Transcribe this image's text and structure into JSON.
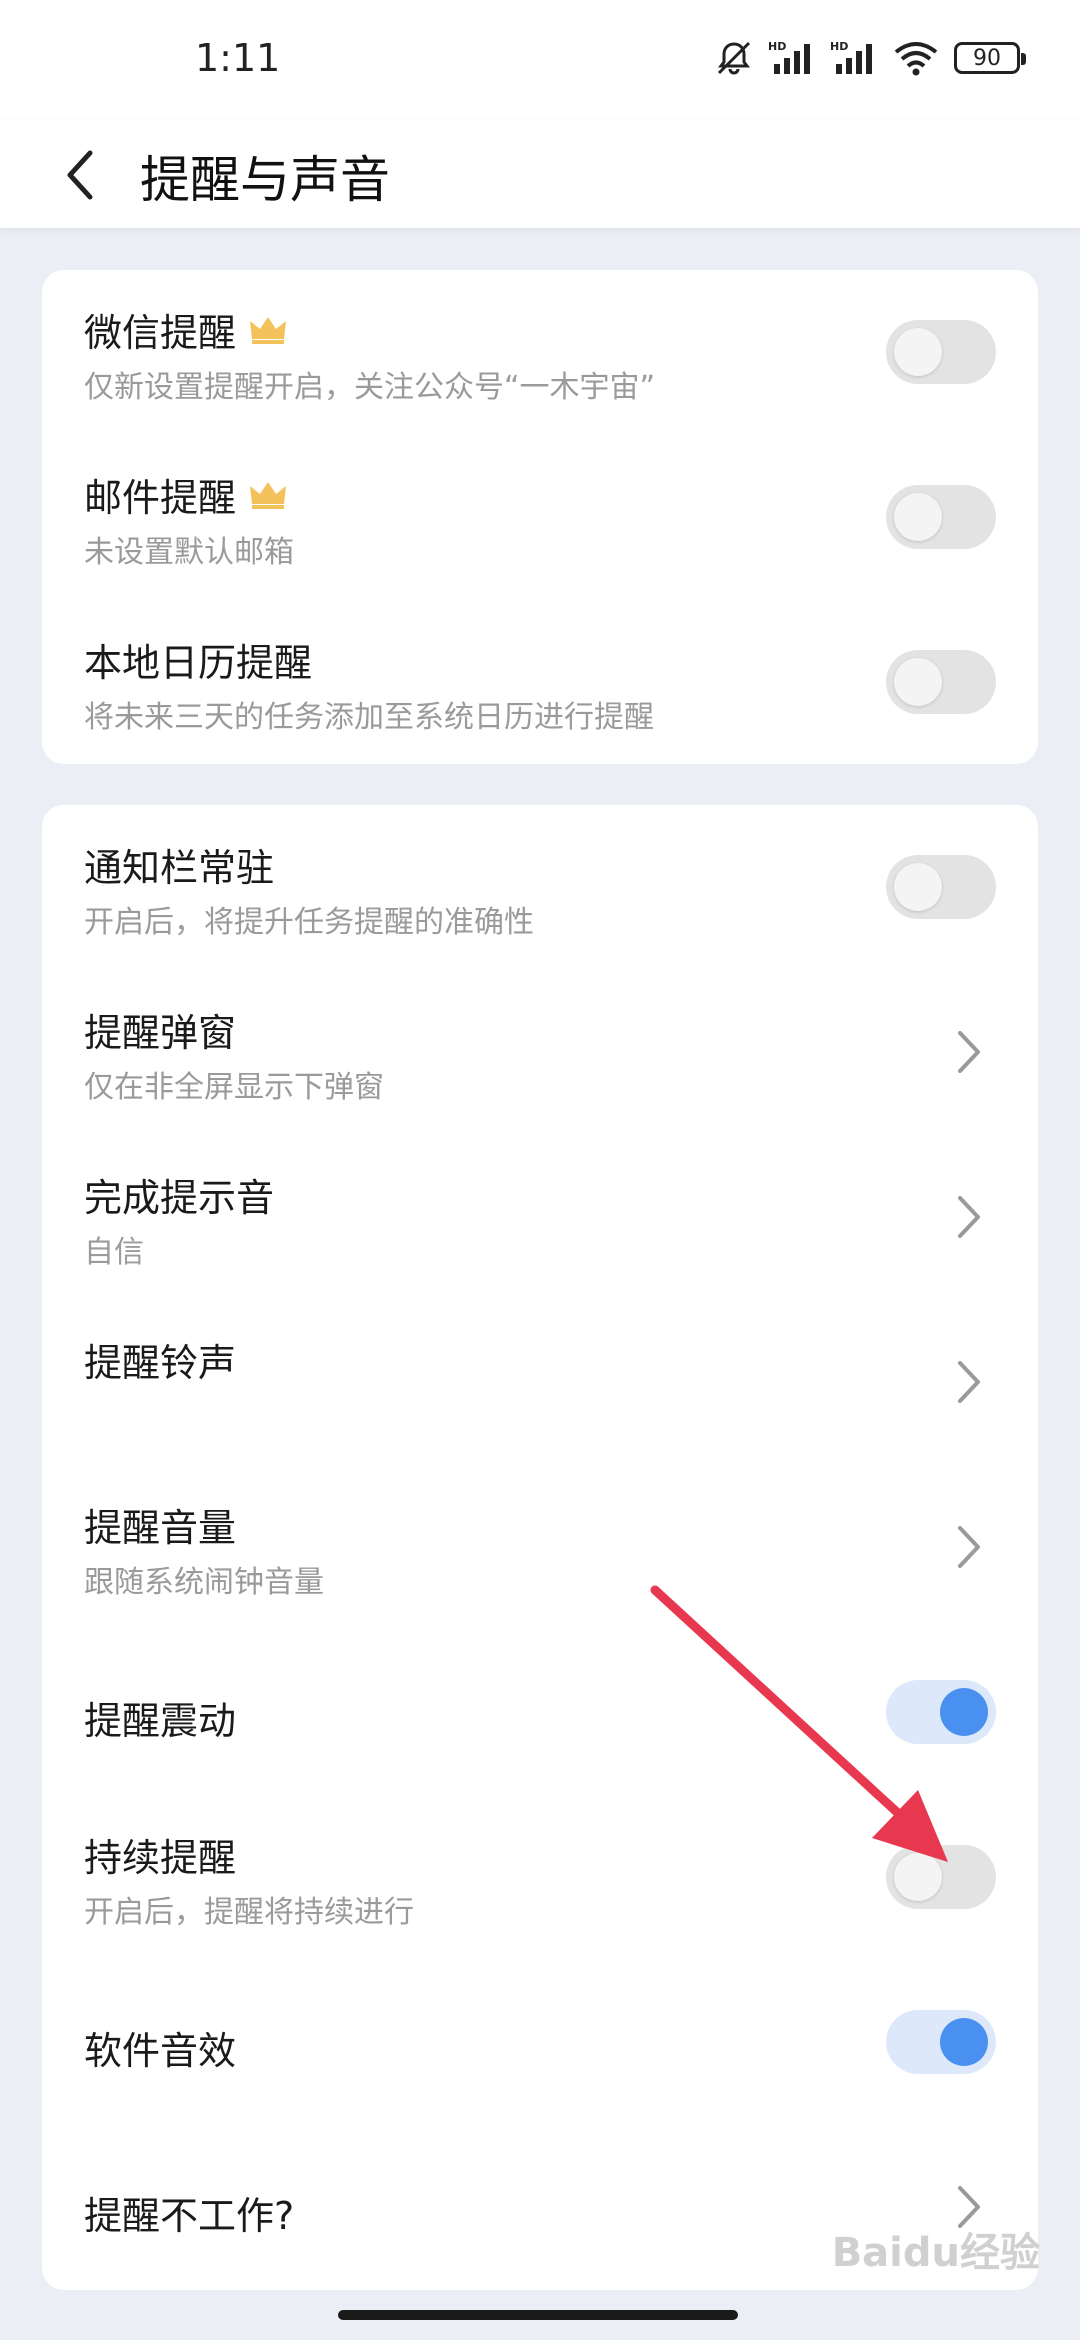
{
  "status": {
    "time": "1:11",
    "battery": "90",
    "hd_label": "HD"
  },
  "header": {
    "title": "提醒与声音"
  },
  "card1": [
    {
      "title": "微信提醒",
      "sub": "仅新设置提醒开启，关注公众号“一木宇宙”",
      "crown": true,
      "control": "toggle",
      "on": false
    },
    {
      "title": "邮件提醒",
      "sub": "未设置默认邮箱",
      "crown": true,
      "control": "toggle",
      "on": false
    },
    {
      "title": "本地日历提醒",
      "sub": "将未来三天的任务添加至系统日历进行提醒",
      "crown": false,
      "control": "toggle",
      "on": false
    }
  ],
  "card2": [
    {
      "title": "通知栏常驻",
      "sub": "开启后，将提升任务提醒的准确性",
      "control": "toggle",
      "on": false
    },
    {
      "title": "提醒弹窗",
      "sub": "仅在非全屏显示下弹窗",
      "control": "chevron"
    },
    {
      "title": "完成提示音",
      "sub": "自信",
      "control": "chevron"
    },
    {
      "title": "提醒铃声",
      "sub": "",
      "control": "chevron"
    },
    {
      "title": "提醒音量",
      "sub": "跟随系统闹钟音量",
      "control": "chevron"
    },
    {
      "title": "提醒震动",
      "sub": "",
      "control": "toggle",
      "on": true
    },
    {
      "title": "持续提醒",
      "sub": "开启后，提醒将持续进行",
      "control": "toggle",
      "on": false
    },
    {
      "title": "软件音效",
      "sub": "",
      "control": "toggle",
      "on": true
    },
    {
      "title": "提醒不工作?",
      "sub": "",
      "control": "chevron"
    }
  ],
  "watermark": "Baidu经验",
  "colors": {
    "accent": "#4a90f0",
    "toggle_off": "#e3e3e3",
    "toggle_on_track": "#dde9fb",
    "annotation_arrow": "#e8384f",
    "crown": "#f3c25b",
    "page_bg": "#ebeff5"
  },
  "icons": {
    "back": "chevron-left-icon",
    "crown": "crown-icon",
    "chevron": "chevron-right-icon"
  }
}
